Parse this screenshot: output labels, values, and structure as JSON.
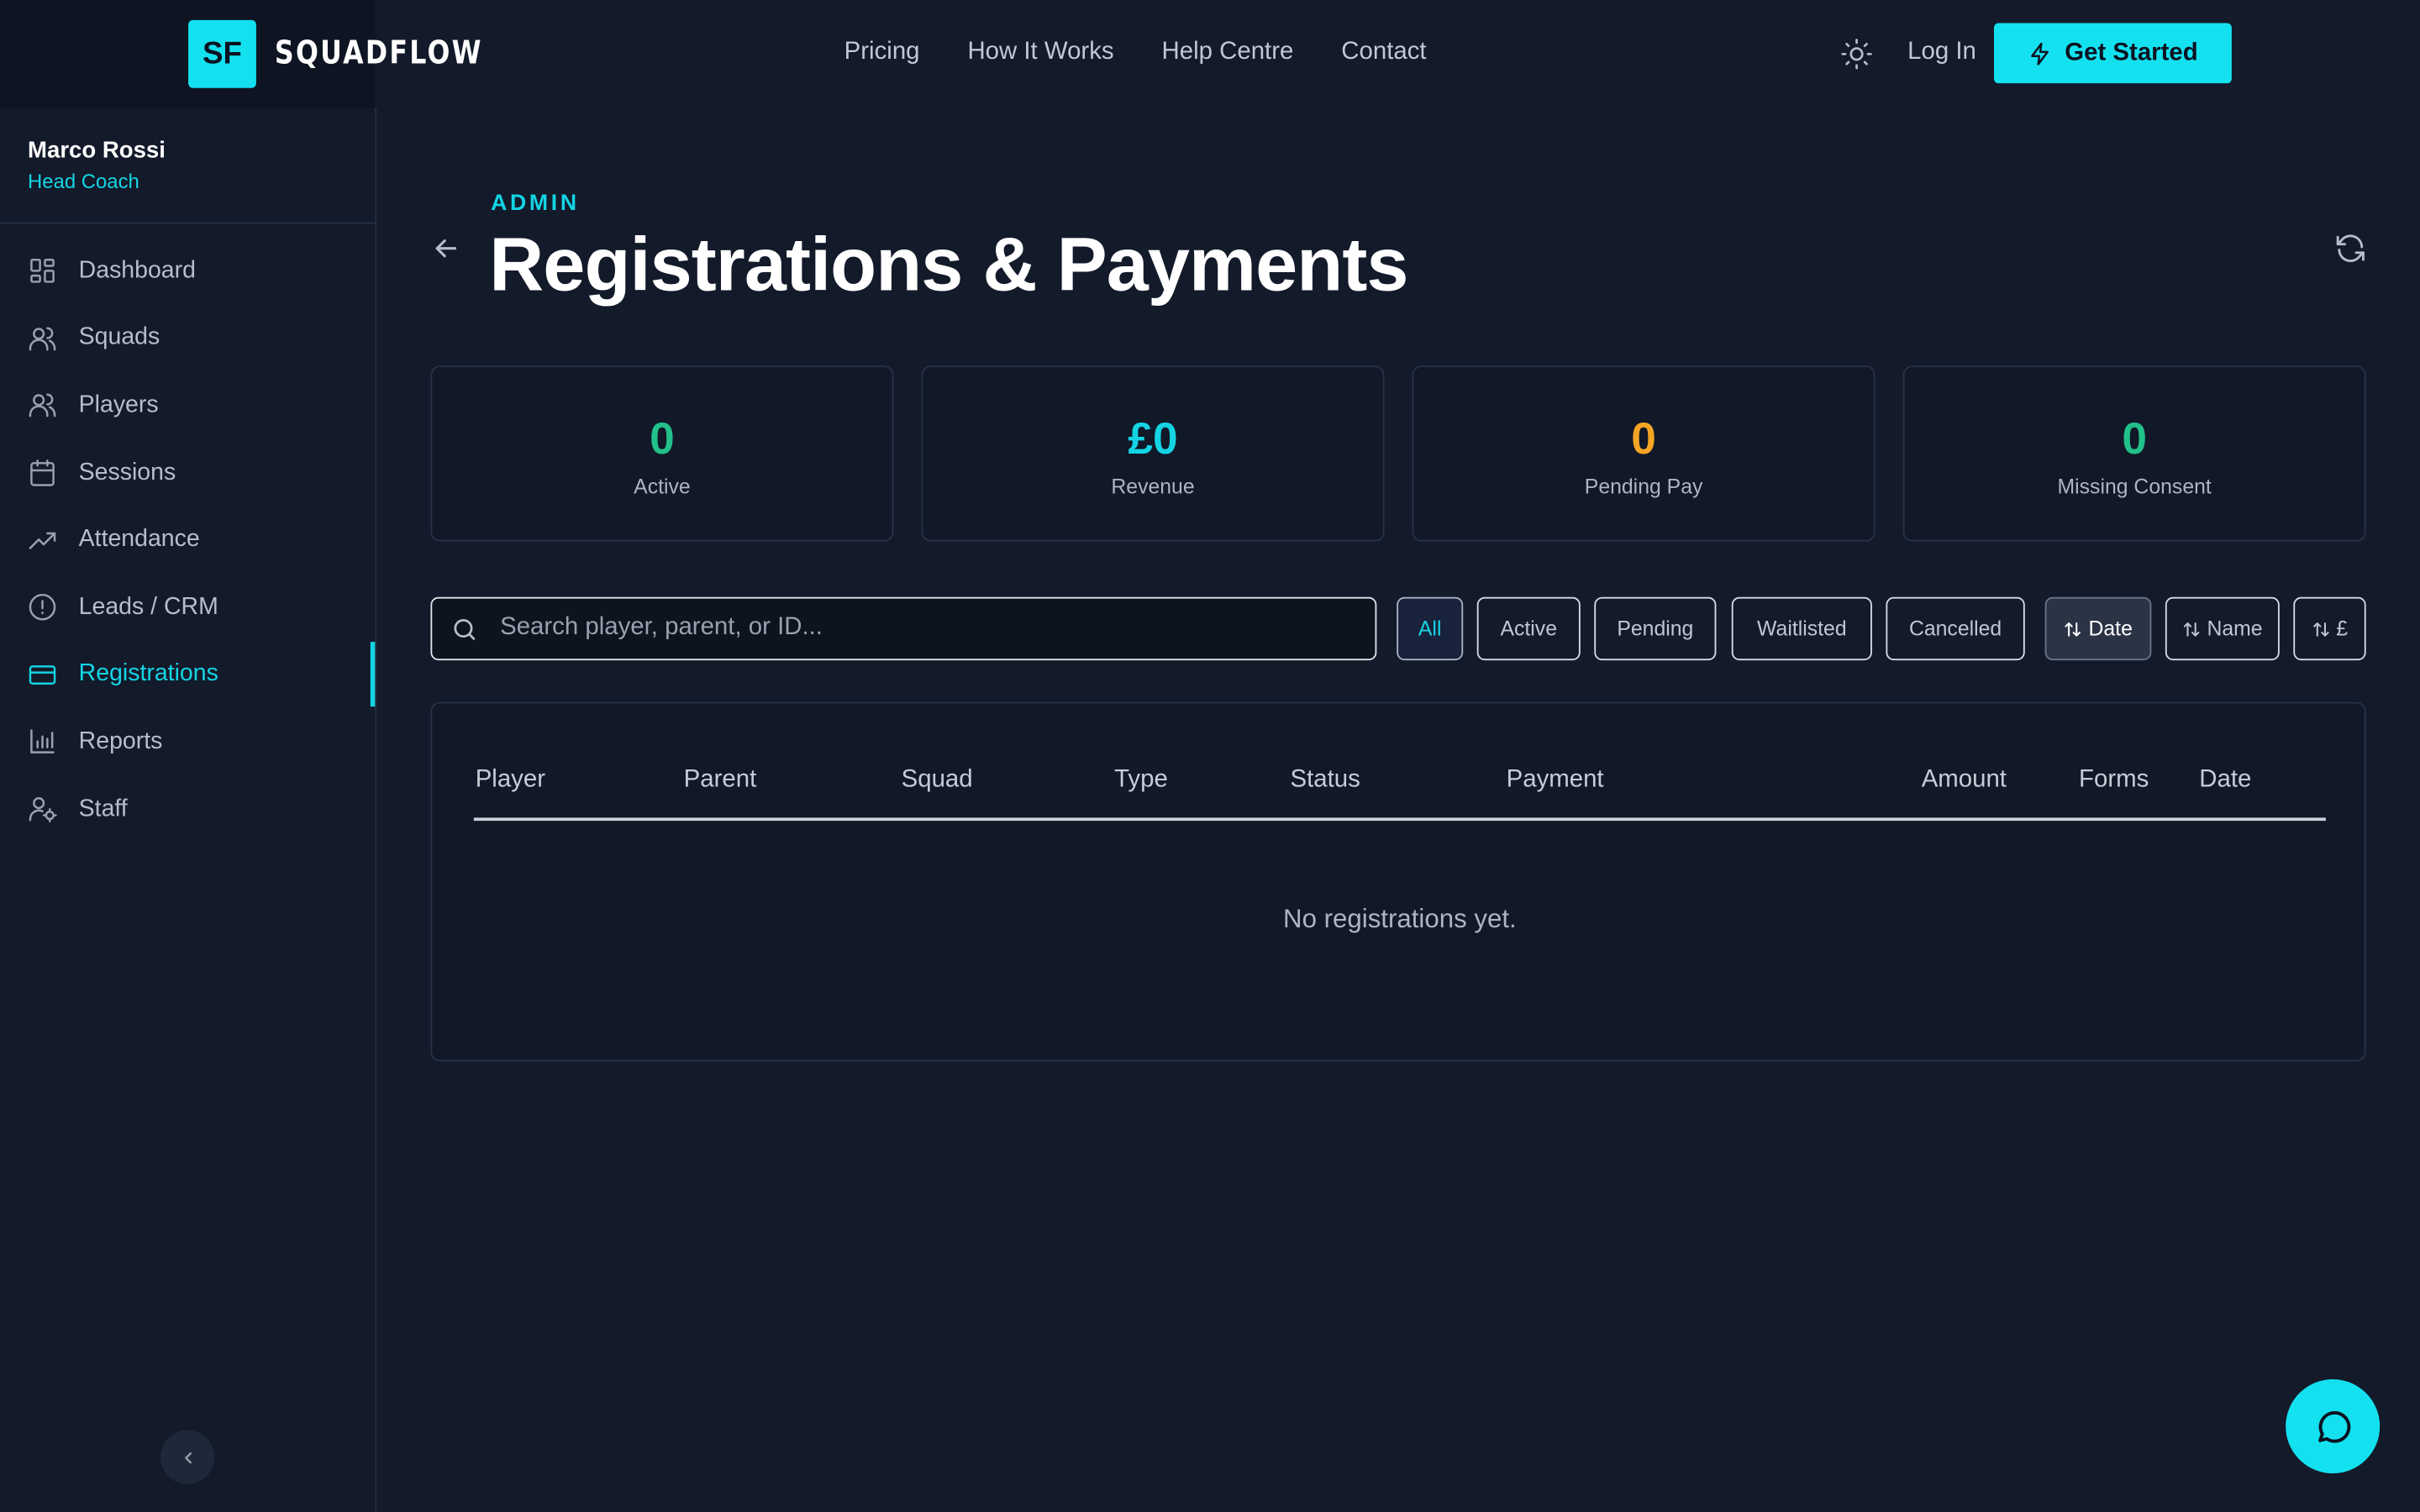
{
  "brand": {
    "logo_initials": "SF",
    "name": "SQUADFLOW"
  },
  "nav": {
    "items": [
      "Pricing",
      "How It Works",
      "Help Centre",
      "Contact"
    ],
    "login": "Log In",
    "cta": "Get Started"
  },
  "user": {
    "name": "Marco Rossi",
    "role": "Head Coach"
  },
  "sidebar": {
    "items": [
      {
        "label": "Dashboard",
        "icon": "dashboard-icon"
      },
      {
        "label": "Squads",
        "icon": "users-icon"
      },
      {
        "label": "Players",
        "icon": "users-icon"
      },
      {
        "label": "Sessions",
        "icon": "calendar-icon"
      },
      {
        "label": "Attendance",
        "icon": "trending-up-icon"
      },
      {
        "label": "Leads / CRM",
        "icon": "alert-circle-icon"
      },
      {
        "label": "Registrations",
        "icon": "credit-card-icon",
        "active": true
      },
      {
        "label": "Reports",
        "icon": "bar-chart-icon"
      },
      {
        "label": "Staff",
        "icon": "user-cog-icon"
      }
    ]
  },
  "page": {
    "eyebrow": "ADMIN",
    "title": "Registrations & Payments"
  },
  "stats": [
    {
      "value": "0",
      "label": "Active",
      "color": "#22c08a"
    },
    {
      "value": "£0",
      "label": "Revenue",
      "color": "#14d4e4"
    },
    {
      "value": "0",
      "label": "Pending Pay",
      "color": "#f5a524"
    },
    {
      "value": "0",
      "label": "Missing Consent",
      "color": "#22c08a"
    }
  ],
  "search": {
    "placeholder": "Search player, parent, or ID..."
  },
  "filters": {
    "all": "All",
    "active": "Active",
    "pending": "Pending",
    "waitlisted": "Waitlisted",
    "cancelled": "Cancelled"
  },
  "sorts": {
    "date": "Date",
    "name": "Name",
    "amount": "£"
  },
  "table": {
    "columns": [
      "Player",
      "Parent",
      "Squad",
      "Type",
      "Status",
      "Payment",
      "Amount",
      "Forms",
      "Date"
    ],
    "empty": "No registrations yet."
  },
  "colors": {
    "accent": "#14e1f0",
    "bg": "#131a2a"
  }
}
